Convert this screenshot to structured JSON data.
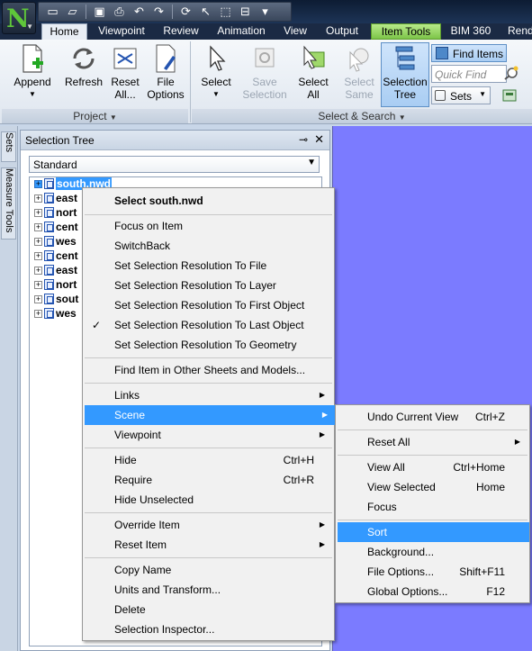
{
  "app": {
    "letter": "N"
  },
  "qat_icons": [
    "new-icon",
    "open-icon",
    "save-icon",
    "print-icon",
    "undo-icon",
    "redo-icon",
    "refresh-icon",
    "select-icon",
    "select-box-icon",
    "collapse-icon"
  ],
  "tabs": [
    "Home",
    "Viewpoint",
    "Review",
    "Animation",
    "View",
    "Output",
    "Item Tools",
    "BIM 360",
    "Rend"
  ],
  "ribbon": {
    "append": "Append",
    "refresh": "Refresh",
    "reset_all_1": "Reset",
    "reset_all_2": "All...",
    "file_options_1": "File",
    "file_options_2": "Options",
    "project_panel": "Project",
    "select": "Select",
    "save_selection_1": "Save",
    "save_selection_2": "Selection",
    "select_all_1": "Select",
    "select_all_2": "All",
    "select_same_1": "Select",
    "select_same_2": "Same",
    "selection_tree_1": "Selection",
    "selection_tree_2": "Tree",
    "find_items": "Find Items",
    "quick_find_placeholder": "Quick Find",
    "sets": "Sets",
    "select_search_panel": "Select & Search"
  },
  "dock_tabs": [
    "Sets",
    "Measure Tools"
  ],
  "tree_panel": {
    "title": "Selection Tree",
    "mode": "Standard",
    "items": [
      "south.nwd",
      "east",
      "nort",
      "cent",
      "wes",
      "cent",
      "east",
      "nort",
      "sout",
      "wes"
    ]
  },
  "context_menu": {
    "items": [
      "Select south.nwd",
      "Focus on Item",
      "SwitchBack",
      "Set Selection Resolution To File",
      "Set Selection Resolution To Layer",
      "Set Selection Resolution To First Object",
      "Set Selection Resolution To Last Object",
      "Set Selection Resolution To Geometry",
      "Find Item in Other Sheets and Models...",
      "Links",
      "Scene",
      "Viewpoint",
      "Hide",
      "Require",
      "Hide Unselected",
      "Override Item",
      "Reset Item",
      "Copy Name",
      "Units and Transform...",
      "Delete",
      "Selection Inspector..."
    ],
    "shortcuts": {
      "hide": "Ctrl+H",
      "require": "Ctrl+R"
    }
  },
  "scene_menu": {
    "items": [
      "Undo Current View",
      "Reset All",
      "View All",
      "View Selected",
      "Focus",
      "Sort",
      "Background...",
      "File Options...",
      "Global Options..."
    ],
    "shortcuts": {
      "undo": "Ctrl+Z",
      "view_all": "Ctrl+Home",
      "view_selected": "Home",
      "file_options": "Shift+F11",
      "global_options": "F12"
    }
  },
  "colors": {
    "highlight": "#3399ff",
    "viewport": "#7b7bff",
    "context_tab": "#8fd35a"
  }
}
